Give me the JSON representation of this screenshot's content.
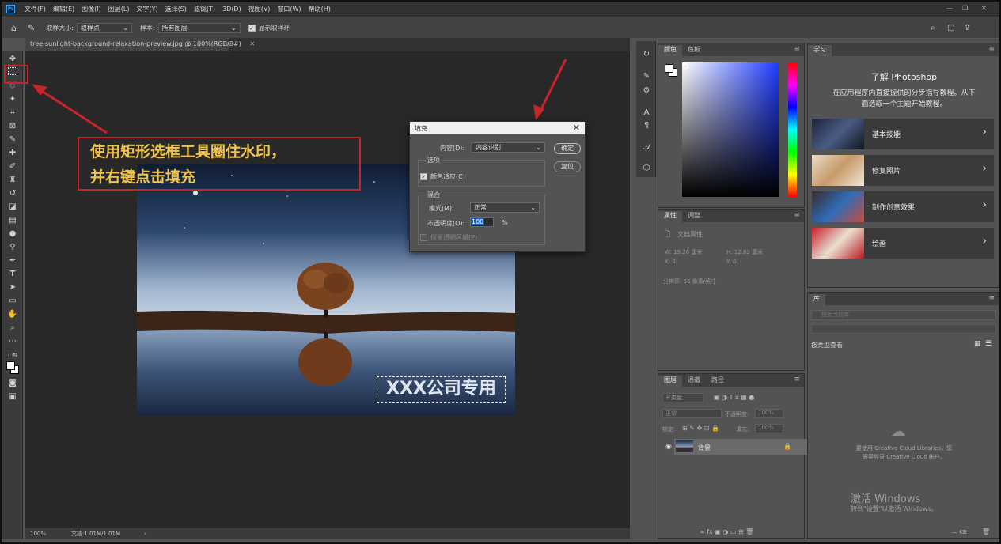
{
  "app": {
    "logo": "Ps"
  },
  "menubar": {
    "items": [
      "文件(F)",
      "编辑(E)",
      "图像(I)",
      "图层(L)",
      "文字(Y)",
      "选择(S)",
      "滤镜(T)",
      "3D(D)",
      "视图(V)",
      "窗口(W)",
      "帮助(H)"
    ],
    "window_controls": [
      "—",
      "❐",
      "✕"
    ]
  },
  "options_bar": {
    "sample_size_label": "取样大小:",
    "sample_size_value": "取样点",
    "sample_label": "样本:",
    "sample_value": "所有图层",
    "show_ring_label": "显示取样环"
  },
  "document": {
    "tab_title": "tree-sunlight-background-relaxation-preview.jpg @ 100%(RGB/8#)",
    "watermark_text": "XXX公司专用",
    "zoom": "100%",
    "doc_info": "文档:1.01M/1.01M"
  },
  "annotation": {
    "line1": "使用矩形选框工具圈住水印，",
    "line2": "并右键点击填充"
  },
  "fill_dialog": {
    "title": "填充",
    "contents_label": "内容(D):",
    "contents_value": "内容识别",
    "ok": "确定",
    "reset": "复位",
    "options_group": "选项",
    "color_adapt": "颜色适应(C)",
    "blend_group": "混合",
    "mode_label": "模式(M):",
    "mode_value": "正常",
    "opacity_label": "不透明度(O):",
    "opacity_value": "100",
    "opacity_unit": "%",
    "preserve_transparency": "保留透明区域(P)"
  },
  "color_panel": {
    "tabs": [
      "颜色",
      "色板"
    ]
  },
  "properties_panel": {
    "tabs": [
      "属性",
      "调整"
    ],
    "doc_props": "文档属性",
    "w": "W:  19.26 厘米",
    "h": "H:  12.83 厘米",
    "x": "X:  0",
    "y": "Y:  0",
    "resolution": "分辨率: 96 像素/英寸"
  },
  "layers_panel": {
    "tabs": [
      "图层",
      "通道",
      "路径"
    ],
    "filter": "Ｐ类型",
    "blend_mode": "正常",
    "opacity_label": "不透明度:",
    "opacity_value": "100%",
    "lock_label": "锁定:",
    "fill_label": "填充:",
    "fill_value": "100%",
    "layer_name": "背景"
  },
  "learn_panel": {
    "tab": "学习",
    "heading": "了解 Photoshop",
    "desc_line1": "在应用程序内直接提供的分步指导教程。从下",
    "desc_line2": "面选取一个主题开始教程。",
    "cards": [
      "基本技能",
      "修复照片",
      "制作创意效果",
      "绘画"
    ]
  },
  "library_panel": {
    "tab": "库",
    "search_placeholder": "搜索当前库",
    "view_by": "按类型查看",
    "cc_line1": "要使用 Creative Cloud Libraries，您",
    "cc_line2": "需要登录 Creative Cloud 帐户。",
    "size": "— KB"
  },
  "windows_activation": {
    "line1": "激活 Windows",
    "line2": "转到\"设置\"以激活 Windows。"
  }
}
